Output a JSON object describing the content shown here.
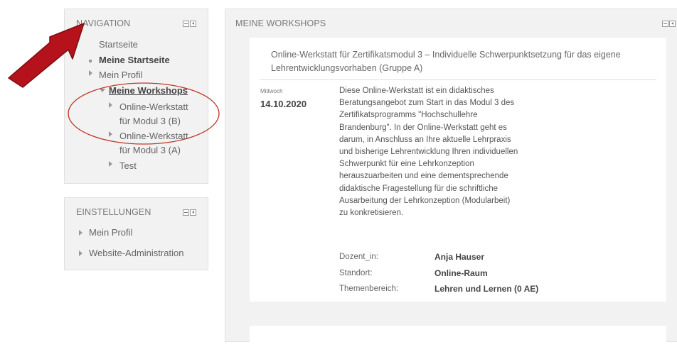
{
  "navigation": {
    "title": "NAVIGATION",
    "items": [
      {
        "label": "Startseite"
      },
      {
        "label": "Meine Startseite"
      },
      {
        "label": "Mein Profil"
      },
      {
        "label": "Meine Workshops"
      },
      {
        "label": "Online-Werkstatt"
      },
      {
        "label": "für Modul 3 (B)"
      },
      {
        "label": "Online-Werkstatt"
      },
      {
        "label": "für Modul 3 (A)"
      },
      {
        "label": "Test"
      }
    ]
  },
  "settings": {
    "title": "EINSTELLUNGEN",
    "items": [
      {
        "label": "Mein Profil"
      },
      {
        "label": "Website-Administration"
      }
    ]
  },
  "workshops": {
    "title": "MEINE WORKSHOPS",
    "card": {
      "title_line1": "Online-Werkstatt für Zertifikatsmodul 3 – Individuelle Schwerpunktsetzung für das eigene",
      "title_line2": "Lehrentwicklungsvorhaben (Gruppe A)",
      "weekday": "Mittwoch",
      "date": "14.10.2020",
      "description": [
        "Diese Online-Werkstatt ist ein didaktisches",
        "Beratungsangebot zum Start in das Modul 3 des",
        "Zertifikatsprogramms \"Hochschullehre",
        "Brandenburg\". In der Online-Werkstatt geht es",
        "darum, in Anschluss an Ihre aktuelle Lehrpraxis",
        "und bisherige Lehrentwicklung Ihren individuellen",
        "Schwerpunkt für eine Lehrkonzeption",
        "herauszuarbeiten und eine dementsprechende",
        "didaktische Fragestellung für die schriftliche",
        "Ausarbeitung der Lehrkonzeption (Modularbeit)",
        "zu konkretisieren."
      ],
      "meta": [
        {
          "label": "Dozent_in:",
          "value": "Anja Hauser"
        },
        {
          "label": "Standort:",
          "value": "Online-Raum"
        },
        {
          "label": "Themenbereich:",
          "value": "Lehren und Lernen (0 AE)"
        }
      ]
    }
  },
  "annotations": {
    "arrow_color": "#b5121b",
    "ellipse_color": "#c0392b"
  }
}
